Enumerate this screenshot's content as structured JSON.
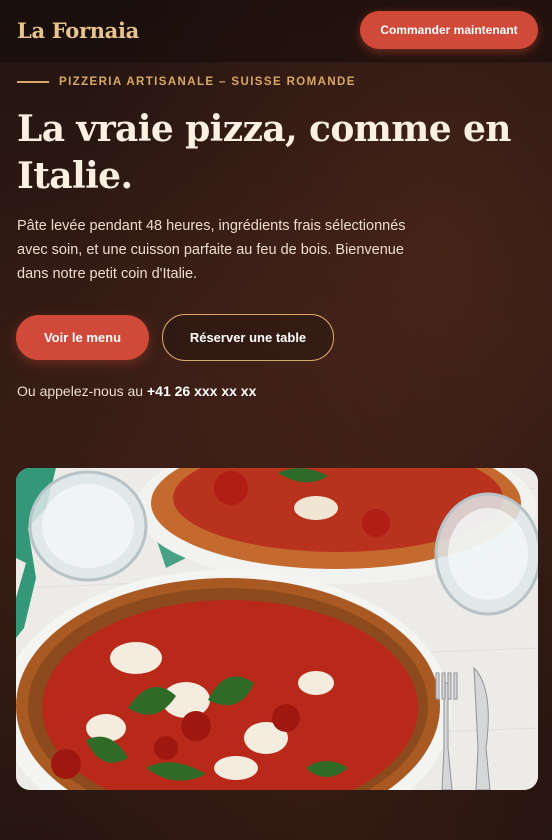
{
  "header": {
    "logo": "La Fornaia",
    "order_button": "Commander maintenant"
  },
  "hero": {
    "eyebrow": "PIZZERIA ARTISANALE – SUISSE ROMANDE",
    "title": "La vraie pizza, comme en Italie.",
    "lead": "Pâte levée pendant 48 heures, ingrédients frais sélectionnés avec soin, et une cuisson parfaite au feu de bois. Bienvenue dans notre petit coin d'Italie.",
    "menu_button": "Voir le menu",
    "reserve_button": "Réserver une table",
    "call_prefix": "Ou appelez-nous au",
    "phone": "+41 26 xxx xx xx"
  },
  "colors": {
    "accent": "#d14a39",
    "gold": "#d8a964",
    "background": "#2a1712"
  }
}
